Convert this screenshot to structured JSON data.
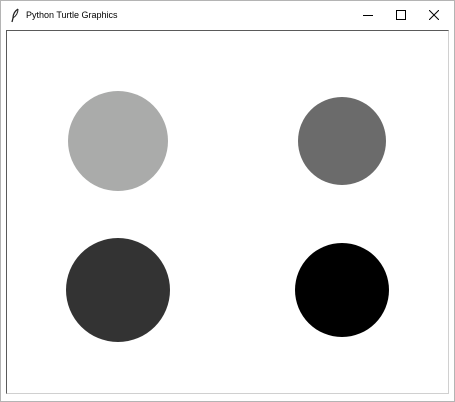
{
  "window": {
    "title": "Python Turtle Graphics",
    "icon": "feather-icon",
    "controls": {
      "minimize": "minimize-icon",
      "maximize": "maximize-icon",
      "close": "close-icon"
    }
  },
  "canvas": {
    "background": "#ffffff",
    "dots": [
      {
        "name": "dot-top-left",
        "color": "#aaabaa"
      },
      {
        "name": "dot-top-right",
        "color": "#6b6b6b"
      },
      {
        "name": "dot-bottom-left",
        "color": "#333333"
      },
      {
        "name": "dot-bottom-right",
        "color": "#000000"
      }
    ]
  }
}
